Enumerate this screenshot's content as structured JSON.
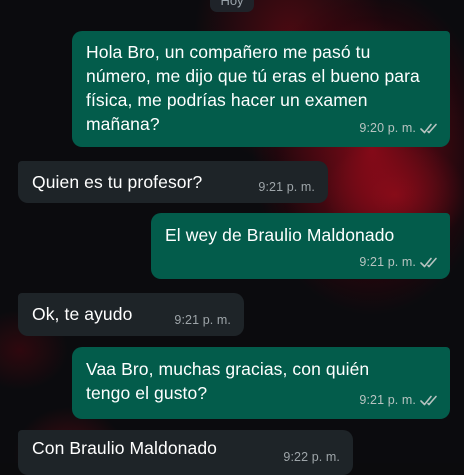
{
  "chat": {
    "day_label": "Hoy",
    "colors": {
      "outgoing_bubble": "#035c4b",
      "incoming_bubble": "#1e2428",
      "read_tick": "#b7c3c0"
    },
    "messages": [
      {
        "direction": "outgoing",
        "text": "Hola Bro, un compañero me pasó tu número, me dijo que tú eras el bueno para física, me podrías hacer un examen mañana?",
        "time": "9:20 p. m.",
        "status_icon": "double-check-icon"
      },
      {
        "direction": "incoming",
        "text": "Quien es tu profesor?",
        "time": "9:21 p. m."
      },
      {
        "direction": "outgoing",
        "text": "El wey de Braulio Maldonado",
        "time": "9:21 p. m.",
        "status_icon": "double-check-icon"
      },
      {
        "direction": "incoming",
        "text": "Ok, te ayudo",
        "time": "9:21 p. m."
      },
      {
        "direction": "outgoing",
        "text": "Vaa Bro, muchas gracias, con quién tengo el gusto?",
        "time": "9:21 p. m.",
        "status_icon": "double-check-icon"
      },
      {
        "direction": "incoming",
        "text": "Con Braulio Maldonado",
        "time": "9:22 p. m."
      }
    ]
  }
}
